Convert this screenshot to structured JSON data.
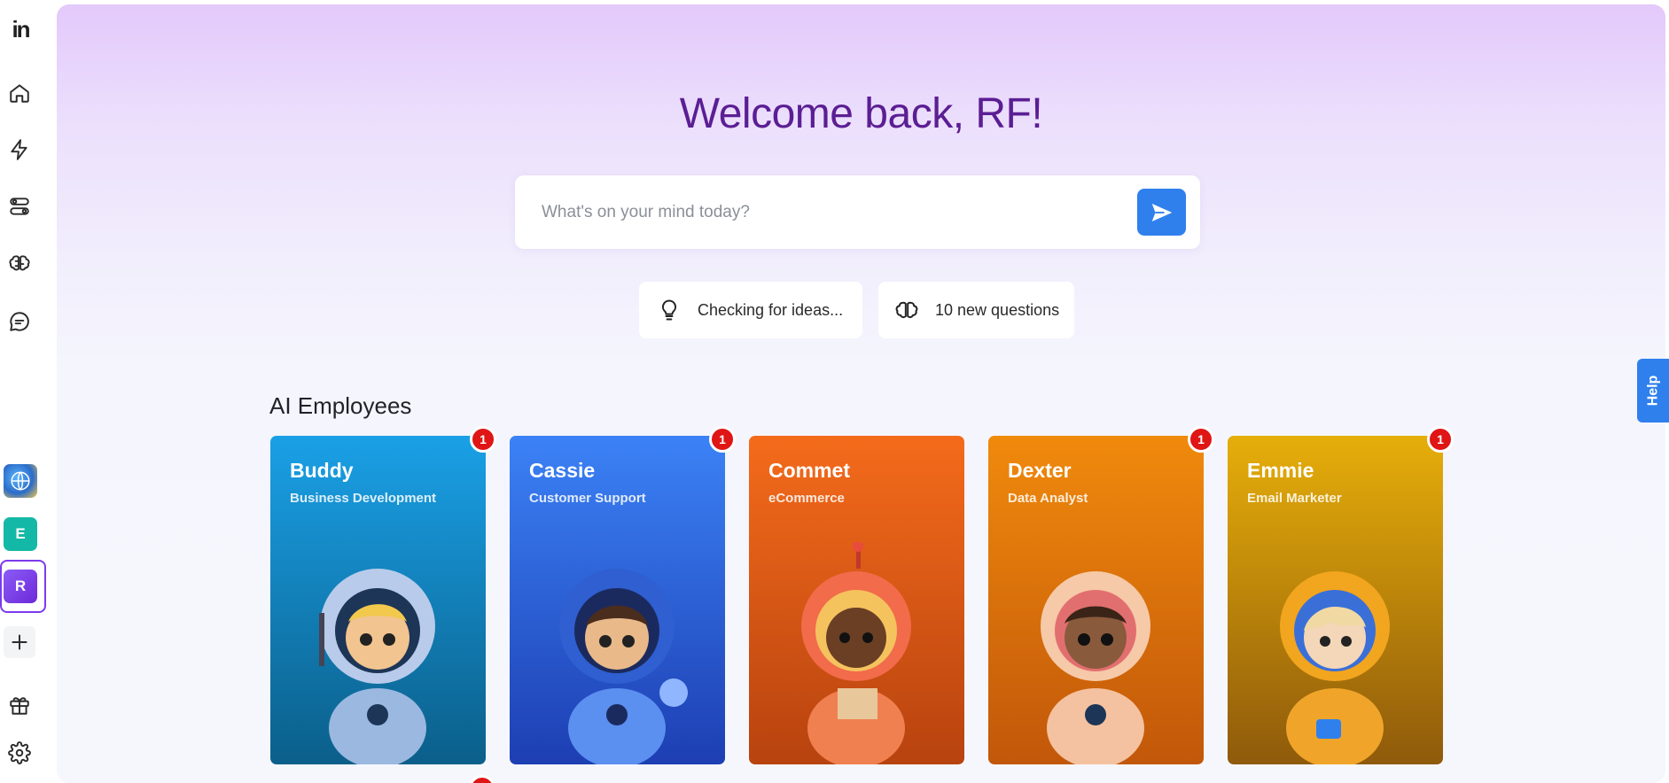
{
  "app": {
    "logo_text": "in"
  },
  "sidebar": {
    "nav": [
      {
        "name": "home",
        "icon": "home-icon"
      },
      {
        "name": "automations",
        "icon": "lightning-icon"
      },
      {
        "name": "workflows",
        "icon": "toggles-icon"
      },
      {
        "name": "brain",
        "icon": "brain-icon"
      },
      {
        "name": "chat",
        "icon": "chat-bubble-icon"
      }
    ],
    "workspaces": [
      {
        "label": "",
        "icon": "globe-avatar-icon"
      },
      {
        "label": "E",
        "color": "#14b8a6"
      },
      {
        "label": "R",
        "color": "#7c3aed",
        "selected": true
      }
    ],
    "add_workspace_icon": "plus-icon",
    "bottom": [
      {
        "name": "gifts",
        "icon": "gift-icon"
      },
      {
        "name": "settings",
        "icon": "gear-icon"
      }
    ]
  },
  "header": {
    "welcome": "Welcome back, RF!"
  },
  "search": {
    "placeholder": "What's on your mind today?",
    "value": "",
    "send_icon": "send-icon"
  },
  "chips": [
    {
      "label": "Checking for ideas...",
      "icon": "lightbulb-icon"
    },
    {
      "label": "10 new questions",
      "icon": "brain-icon"
    }
  ],
  "employees": {
    "title": "AI Employees",
    "items": [
      {
        "name": "Buddy",
        "role": "Business Development",
        "badge": "1",
        "colors": [
          "#1aa0e6",
          "#0b5f8a"
        ]
      },
      {
        "name": "Cassie",
        "role": "Customer Support",
        "badge": "1",
        "colors": [
          "#3b82f6",
          "#1d3fb3"
        ]
      },
      {
        "name": "Commet",
        "role": "eCommerce",
        "badge": "",
        "colors": [
          "#f46b1b",
          "#b8430f"
        ]
      },
      {
        "name": "Dexter",
        "role": "Data Analyst",
        "badge": "1",
        "colors": [
          "#f08a0c",
          "#c2570a"
        ]
      },
      {
        "name": "Emmie",
        "role": "Email Marketer",
        "badge": "1",
        "colors": [
          "#e6ae0a",
          "#8f5a0b"
        ]
      }
    ]
  },
  "help": {
    "label": "Help"
  },
  "colors": {
    "accent": "#2f80ed",
    "welcome": "#5b1e93",
    "badge": "#e01515",
    "workspace_selected": "#7c3aed"
  }
}
